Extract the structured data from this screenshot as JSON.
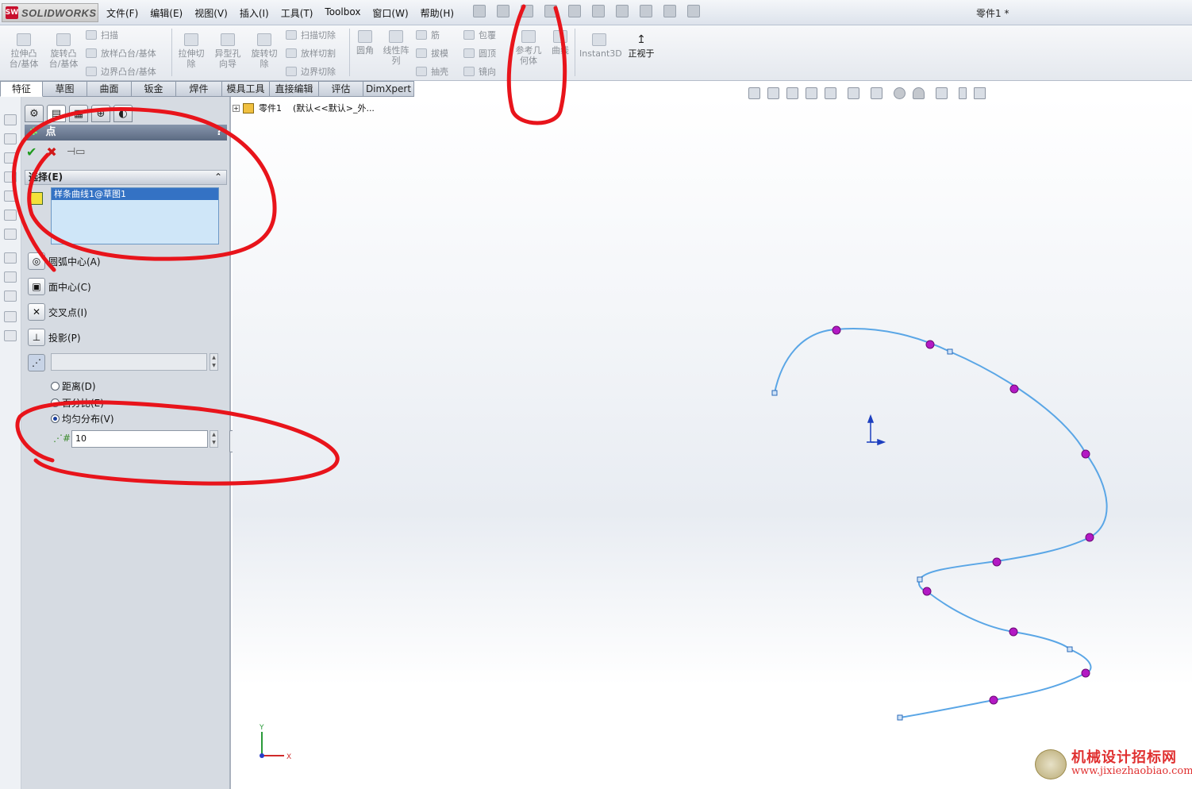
{
  "app": {
    "brand": "SOLIDWORKS",
    "document_title": "零件1 *"
  },
  "menu": [
    "文件(F)",
    "编辑(E)",
    "视图(V)",
    "插入(I)",
    "工具(T)",
    "Toolbox",
    "窗口(W)",
    "帮助(H)"
  ],
  "commands": {
    "extrude_boss": "拉伸凸\n台/基体",
    "revolve_boss": "旋转凸\n台/基体",
    "sweep": "扫描",
    "loft": "放样凸台/基体",
    "boundary": "边界凸台/基体",
    "extrude_cut": "拉伸切\n除",
    "hole_wizard": "异型孔\n向导",
    "revolve_cut": "旋转切\n除",
    "sweep_cut": "扫描切除",
    "loft_cut": "放样切割",
    "boundary_cut": "边界切除",
    "fillet": "圆角",
    "linear_pattern": "线性阵\n列",
    "rib": "筋",
    "draft": "拔模",
    "shell": "抽壳",
    "wrap": "包覆",
    "dome": "圆顶",
    "mirror": "镜向",
    "ref_geometry": "参考几\n何体",
    "curves": "曲线",
    "instant3d": "Instant3D",
    "normal_to": "正视于"
  },
  "tabs": [
    "特征",
    "草图",
    "曲面",
    "钣金",
    "焊件",
    "模具工具",
    "直接编辑",
    "评估",
    "DimXpert"
  ],
  "property_manager": {
    "title": "点",
    "help": "?",
    "selection_header": "选择(E)",
    "selected_item": "样条曲线1@草图1",
    "options": {
      "arc_center": "圆弧中心(A)",
      "face_center": "面中心(C)",
      "intersection": "交叉点(I)",
      "projection": "投影(P)"
    },
    "radio_distance": "距离(D)",
    "radio_percent": "百分比(E)",
    "radio_even": "均匀分布(V)",
    "count_value": "10"
  },
  "tree": {
    "part": "零件1",
    "config": "(默认<<默认>_外..."
  },
  "axis": {
    "y": "Y",
    "x": "X"
  },
  "watermark": {
    "title": "机械设计招标网",
    "url": "www.jixiezhaobiao.com"
  },
  "colors": {
    "annotation_red": "#e8141b",
    "spline": "#5aa6e6",
    "point": "#c020c8",
    "endpoint": "#2a6ab8"
  }
}
